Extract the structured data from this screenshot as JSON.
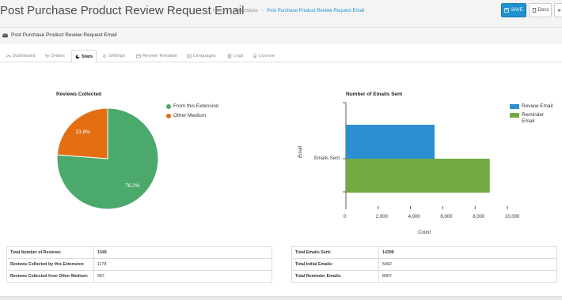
{
  "header": {
    "title": "Post Purchase Product Review Request Email",
    "breadcrumb": [
      "Home",
      "Extensions",
      "Post Purchase Product Review Request Email"
    ],
    "save_label": "SAVE",
    "docs_label": "Docs",
    "back_icon": "arrow-left-icon"
  },
  "panel": {
    "heading": "Post Purchase Product Review Request Email",
    "heading_icon": "envelope-icon"
  },
  "tabs": [
    {
      "label": "Dashboard",
      "icon": "dashboard-icon"
    },
    {
      "label": "Orders",
      "icon": "cart-icon"
    },
    {
      "label": "Stats",
      "icon": "chart-icon"
    },
    {
      "label": "Settings",
      "icon": "gear-icon"
    },
    {
      "label": "Review Template",
      "icon": "template-icon"
    },
    {
      "label": "Languages",
      "icon": "languages-icon"
    },
    {
      "label": "Logs",
      "icon": "logs-icon"
    },
    {
      "label": "License",
      "icon": "license-icon"
    }
  ],
  "active_tab": "Stats",
  "colors": {
    "accent": "#1e91cf",
    "pie_extension": "#4ba96b",
    "pie_other": "#e46f12",
    "bar_review": "#2d8fd1",
    "bar_reminder": "#72ab42"
  },
  "chart_data": [
    {
      "type": "pie",
      "title": "Reviews Collected",
      "labels": [
        "From this Extension",
        "Other Medium"
      ],
      "values": [
        76.2,
        23.8
      ],
      "value_labels": [
        "76.2%",
        "23.8%"
      ],
      "legend_position": "top-right"
    },
    {
      "type": "bar",
      "orientation": "horizontal",
      "title": "Number of Emails Sent",
      "categories": [
        "Emails Sent"
      ],
      "series": [
        {
          "name": "Review Email",
          "values": [
            5492
          ]
        },
        {
          "name": "Reminder Email",
          "values": [
            8907
          ]
        }
      ],
      "legend_labels": [
        "Review Email",
        "Reminder\nEmail"
      ],
      "xlabel": "Count",
      "ylabel": "Email",
      "xlim": [
        0,
        10000
      ],
      "xticks": [
        "0",
        "2,000",
        "4,000",
        "6,000",
        "8,000",
        "10,000"
      ],
      "xtick_values": [
        0,
        2000,
        4000,
        6000,
        8000,
        10000
      ],
      "legend_position": "top-right"
    }
  ],
  "reviews_table": [
    {
      "label": "Total Number of Reviews:",
      "value": "1545"
    },
    {
      "label": "Reviews Collected by this Extension:",
      "value": "1178"
    },
    {
      "label": "Reviews Collected from Other Medium:",
      "value": "367"
    }
  ],
  "emails_table": [
    {
      "label": "Total Emails Sent:",
      "value": "14399"
    },
    {
      "label": "Total Initial Emails:",
      "value": "5492"
    },
    {
      "label": "Total Reminder Emails:",
      "value": "8907"
    }
  ]
}
